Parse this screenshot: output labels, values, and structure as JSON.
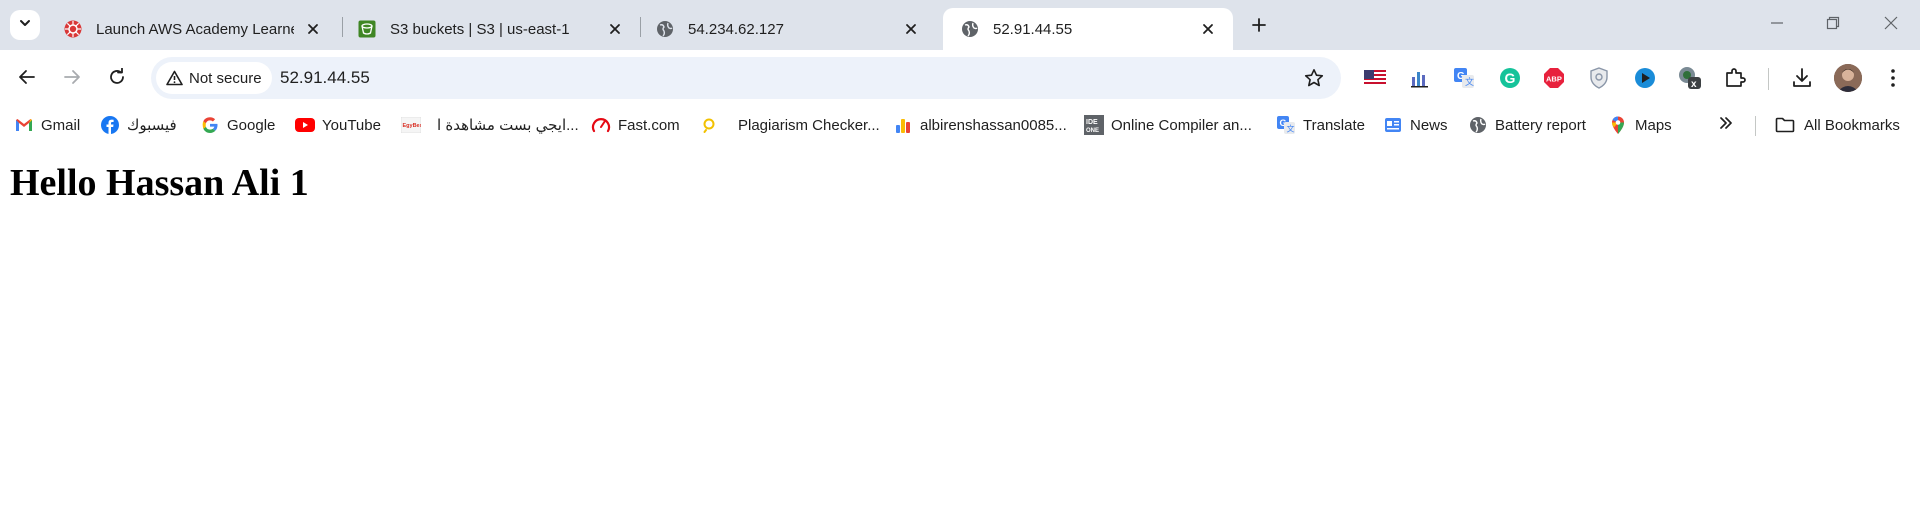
{
  "tabs": [
    {
      "title": "Launch AWS Academy Learner L",
      "favicon": "aws-academy-icon",
      "active": false
    },
    {
      "title": "S3 buckets | S3 | us-east-1",
      "favicon": "s3-icon",
      "active": false
    },
    {
      "title": "54.234.62.127",
      "favicon": "globe-icon",
      "active": false
    },
    {
      "title": "52.91.44.55",
      "favicon": "globe-icon",
      "active": true
    }
  ],
  "toolbar": {
    "security_label": "Not secure",
    "url": "52.91.44.55"
  },
  "bookmarks": [
    {
      "label": "Gmail",
      "icon": "gmail-icon"
    },
    {
      "label": "فيسبوك",
      "icon": "facebook-icon"
    },
    {
      "label": "Google",
      "icon": "google-icon"
    },
    {
      "label": "YouTube",
      "icon": "youtube-icon"
    },
    {
      "label": "ايجي بست مشاهدة ا...",
      "icon": "egybest-icon"
    },
    {
      "label": "Fast.com",
      "icon": "fast-icon"
    },
    {
      "label": "Plagiarism Checker...",
      "icon": "plagiarism-icon"
    },
    {
      "label": "albirenshassan0085...",
      "icon": "analytics-icon"
    },
    {
      "label": "Online Compiler an...",
      "icon": "ideone-icon"
    },
    {
      "label": "Translate",
      "icon": "translate-icon"
    },
    {
      "label": "News",
      "icon": "news-icon"
    },
    {
      "label": "Battery report",
      "icon": "globe-icon"
    },
    {
      "label": "Maps",
      "icon": "maps-icon"
    }
  ],
  "all_bookmarks_label": "All Bookmarks",
  "page": {
    "heading": "Hello Hassan Ali 1"
  },
  "colors": {
    "tabstrip_bg": "#dee3eb",
    "omnibox_bg": "#edf2fa",
    "page_bg": "#ffffff"
  }
}
